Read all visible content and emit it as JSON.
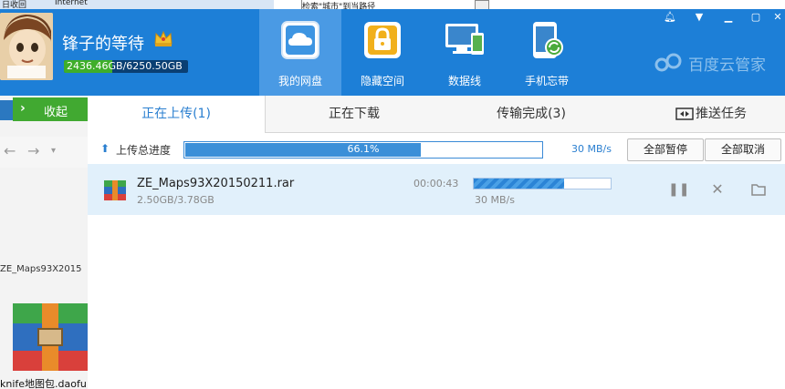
{
  "background": {
    "menu_items": [
      "日收回",
      "Internet"
    ],
    "window_title_fragment": "检索\"城市\"到当路径",
    "filename_fragment": "ZE_Maps93X2015",
    "archive_caption": "knife地图包.daofu"
  },
  "header": {
    "username": "锋子的等待",
    "quota": {
      "used": "2436.46GB",
      "total": "6250.50GB",
      "used_fraction": 0.39
    },
    "nav": [
      {
        "label": "我的网盘",
        "icon": "cloud-drive-icon",
        "active": true
      },
      {
        "label": "隐藏空间",
        "icon": "lock-icon",
        "active": false
      },
      {
        "label": "数据线",
        "icon": "devices-icon",
        "active": false
      },
      {
        "label": "手机忘带",
        "icon": "phone-sync-icon",
        "active": false
      }
    ],
    "brand": "百度云管家",
    "window_controls": [
      "bell-icon",
      "menu-down-icon",
      "minimize-icon",
      "maximize-icon",
      "close-icon"
    ]
  },
  "sidebar": {
    "collapse_label": "收起"
  },
  "tabs": {
    "uploading": "正在上传(1)",
    "downloading": "正在下载",
    "completed": "传输完成(3)",
    "push": "推送任务"
  },
  "overall": {
    "label": "上传总进度",
    "percent_text": "66.1%",
    "progress": 0.661,
    "speed": "30 MB/s",
    "pause_all": "全部暂停",
    "cancel_all": "全部取消"
  },
  "transfer": {
    "file_name": "ZE_Maps93X20150211.rar",
    "size_text": "2.50GB/3.78GB",
    "time_remaining": "00:00:43",
    "progress": 0.66,
    "speed": "30 MB/s"
  },
  "colors": {
    "header_bg": "#1d7fd7",
    "active_nav": "#4a9ae4",
    "collapse_green": "#41a931",
    "row_highlight": "#e1f0fb",
    "accent": "#2a7fd0"
  }
}
